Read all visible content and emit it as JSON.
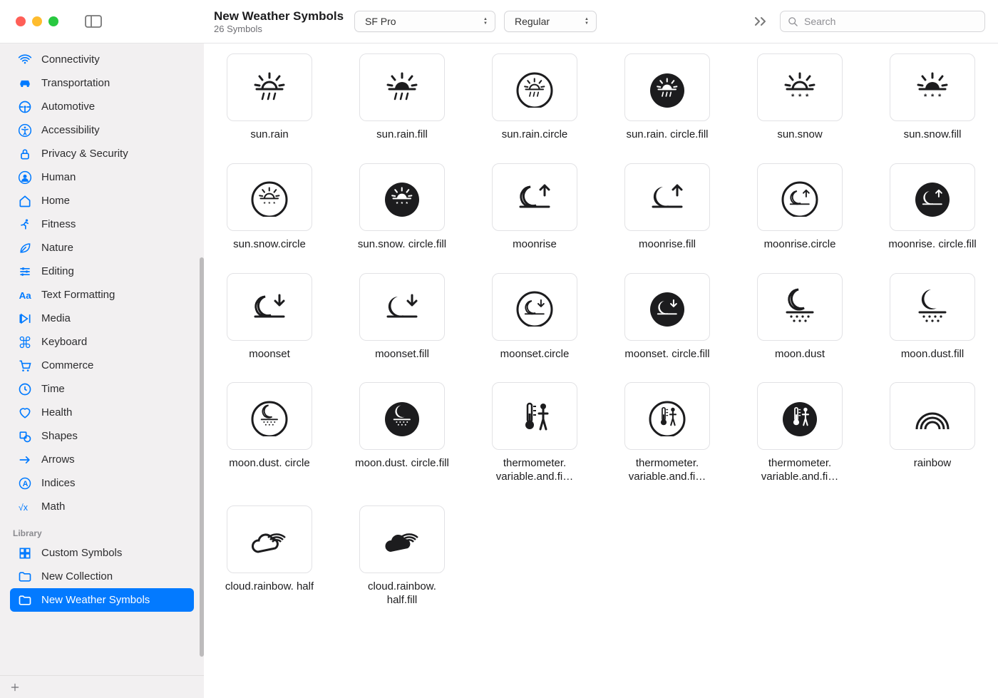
{
  "window": {
    "title": "New Weather Symbols",
    "subtitle": "26 Symbols"
  },
  "toolbar": {
    "font_family": "SF Pro",
    "font_weight": "Regular",
    "search_placeholder": "Search"
  },
  "sidebar": {
    "categories": [
      {
        "label": "Connectivity",
        "icon": "wifi-icon"
      },
      {
        "label": "Transportation",
        "icon": "car-icon"
      },
      {
        "label": "Automotive",
        "icon": "steering-icon"
      },
      {
        "label": "Accessibility",
        "icon": "accessibility-icon"
      },
      {
        "label": "Privacy & Security",
        "icon": "lock-icon"
      },
      {
        "label": "Human",
        "icon": "person-circle-icon"
      },
      {
        "label": "Home",
        "icon": "home-icon"
      },
      {
        "label": "Fitness",
        "icon": "running-icon"
      },
      {
        "label": "Nature",
        "icon": "leaf-icon"
      },
      {
        "label": "Editing",
        "icon": "sliders-icon"
      },
      {
        "label": "Text Formatting",
        "icon": "text-icon"
      },
      {
        "label": "Media",
        "icon": "media-icon"
      },
      {
        "label": "Keyboard",
        "icon": "command-icon"
      },
      {
        "label": "Commerce",
        "icon": "cart-icon"
      },
      {
        "label": "Time",
        "icon": "clock-icon"
      },
      {
        "label": "Health",
        "icon": "heart-icon"
      },
      {
        "label": "Shapes",
        "icon": "shapes-icon"
      },
      {
        "label": "Arrows",
        "icon": "arrow-icon"
      },
      {
        "label": "Indices",
        "icon": "indices-icon"
      },
      {
        "label": "Math",
        "icon": "math-icon"
      }
    ],
    "library_header": "Library",
    "library": [
      {
        "label": "Custom Symbols",
        "icon": "grid-icon",
        "selected": false
      },
      {
        "label": "New Collection",
        "icon": "folder-icon",
        "selected": false
      },
      {
        "label": "New Weather Symbols",
        "icon": "folder-icon",
        "selected": true
      }
    ]
  },
  "symbols": [
    {
      "name": "sun.rain",
      "glyph": "sun-rain"
    },
    {
      "name": "sun.rain.fill",
      "glyph": "sun-rain-fill"
    },
    {
      "name": "sun.rain.circle",
      "glyph": "sun-rain-circle"
    },
    {
      "name": "sun.rain. circle.fill",
      "glyph": "sun-rain-circle-fill"
    },
    {
      "name": "sun.snow",
      "glyph": "sun-snow"
    },
    {
      "name": "sun.snow.fill",
      "glyph": "sun-snow-fill"
    },
    {
      "name": "sun.snow.circle",
      "glyph": "sun-snow-circle"
    },
    {
      "name": "sun.snow. circle.fill",
      "glyph": "sun-snow-circle-fill"
    },
    {
      "name": "moonrise",
      "glyph": "moonrise"
    },
    {
      "name": "moonrise.fill",
      "glyph": "moonrise-fill"
    },
    {
      "name": "moonrise.circle",
      "glyph": "moonrise-circle"
    },
    {
      "name": "moonrise. circle.fill",
      "glyph": "moonrise-circle-fill"
    },
    {
      "name": "moonset",
      "glyph": "moonset"
    },
    {
      "name": "moonset.fill",
      "glyph": "moonset-fill"
    },
    {
      "name": "moonset.circle",
      "glyph": "moonset-circle"
    },
    {
      "name": "moonset. circle.fill",
      "glyph": "moonset-circle-fill"
    },
    {
      "name": "moon.dust",
      "glyph": "moon-dust"
    },
    {
      "name": "moon.dust.fill",
      "glyph": "moon-dust-fill"
    },
    {
      "name": "moon.dust. circle",
      "glyph": "moon-dust-circle"
    },
    {
      "name": "moon.dust. circle.fill",
      "glyph": "moon-dust-circle-fill"
    },
    {
      "name": "thermometer. variable.and.fi…",
      "glyph": "thermo-person"
    },
    {
      "name": "thermometer. variable.and.fi…",
      "glyph": "thermo-person-circle"
    },
    {
      "name": "thermometer. variable.and.fi…",
      "glyph": "thermo-person-circle-fill"
    },
    {
      "name": "rainbow",
      "glyph": "rainbow"
    },
    {
      "name": "cloud.rainbow. half",
      "glyph": "cloud-rainbow"
    },
    {
      "name": "cloud.rainbow. half.fill",
      "glyph": "cloud-rainbow-fill"
    }
  ]
}
